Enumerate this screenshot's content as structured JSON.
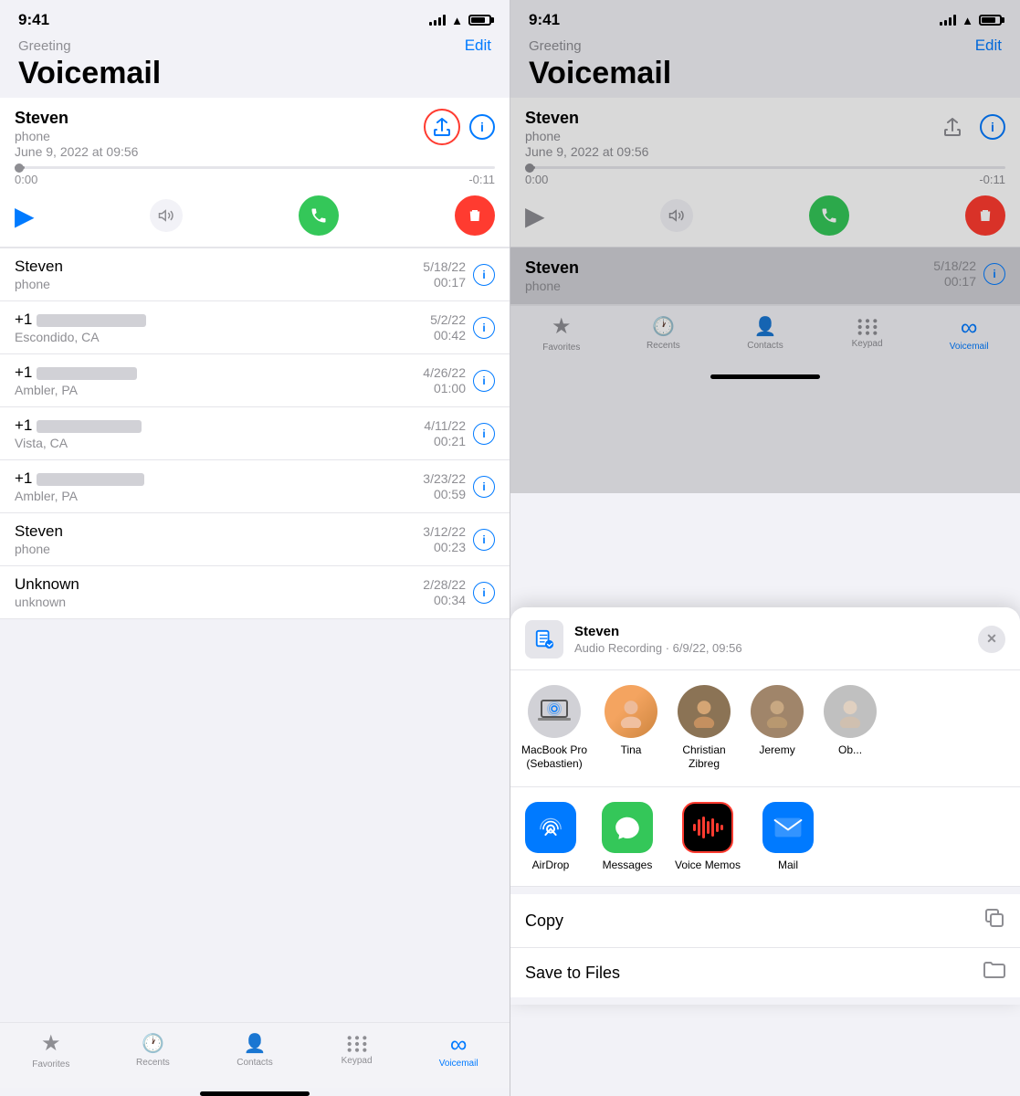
{
  "left_panel": {
    "status": {
      "time": "9:41"
    },
    "header": {
      "greeting": "Greeting",
      "edit": "Edit",
      "title": "Voicemail"
    },
    "active_voicemail": {
      "name": "Steven",
      "type": "phone",
      "date": "June 9, 2022 at 09:56",
      "progress_start": "0:00",
      "progress_end": "-0:11"
    },
    "voicemail_list": [
      {
        "name": "Steven",
        "sub": "phone",
        "date": "5/18/22",
        "duration": "00:17"
      },
      {
        "name": "+1",
        "sub": "Escondido, CA",
        "date": "5/2/22",
        "duration": "00:42"
      },
      {
        "name": "+1",
        "sub": "Ambler, PA",
        "date": "4/26/22",
        "duration": "01:00"
      },
      {
        "name": "+1",
        "sub": "Vista, CA",
        "date": "4/11/22",
        "duration": "00:21"
      },
      {
        "name": "+1",
        "sub": "Ambler, PA",
        "date": "3/23/22",
        "duration": "00:59"
      },
      {
        "name": "Steven",
        "sub": "phone",
        "date": "3/12/22",
        "duration": "00:23"
      },
      {
        "name": "Unknown",
        "sub": "unknown",
        "date": "2/28/22",
        "duration": "00:34"
      }
    ],
    "tab_bar": {
      "tabs": [
        {
          "label": "Favorites",
          "icon": "★",
          "active": false
        },
        {
          "label": "Recents",
          "icon": "🕐",
          "active": false
        },
        {
          "label": "Contacts",
          "icon": "👤",
          "active": false
        },
        {
          "label": "Keypad",
          "icon": "⠿",
          "active": false
        },
        {
          "label": "Voicemail",
          "icon": "∞",
          "active": true
        }
      ]
    }
  },
  "right_panel": {
    "status": {
      "time": "9:41"
    },
    "header": {
      "greeting": "Greeting",
      "edit": "Edit",
      "title": "Voicemail"
    },
    "active_voicemail": {
      "name": "Steven",
      "type": "phone",
      "date": "June 9, 2022 at 09:56",
      "progress_start": "0:00",
      "progress_end": "-0:11"
    },
    "voicemail_list_item": {
      "name": "Steven",
      "sub": "phone",
      "date": "5/18/22",
      "duration": "00:17"
    },
    "share_sheet": {
      "file_name": "Steven",
      "file_sub": "Audio Recording · 6/9/22, 09:56",
      "close": "×",
      "contacts": [
        {
          "label": "MacBook Pro\n(Sebastien)",
          "type": "macbook"
        },
        {
          "label": "Tina",
          "type": "person"
        },
        {
          "label": "Christian\nZibreg",
          "type": "person"
        },
        {
          "label": "Jeremy",
          "type": "person"
        },
        {
          "label": "Ob...",
          "type": "person"
        }
      ],
      "apps": [
        {
          "label": "AirDrop",
          "type": "airdrop"
        },
        {
          "label": "Messages",
          "type": "messages"
        },
        {
          "label": "Voice Memos",
          "type": "voicememos",
          "highlighted": true
        },
        {
          "label": "Mail",
          "type": "mail"
        }
      ],
      "actions": [
        {
          "label": "Copy",
          "icon": "copy"
        },
        {
          "label": "Save to Files",
          "icon": "folder"
        }
      ]
    }
  }
}
